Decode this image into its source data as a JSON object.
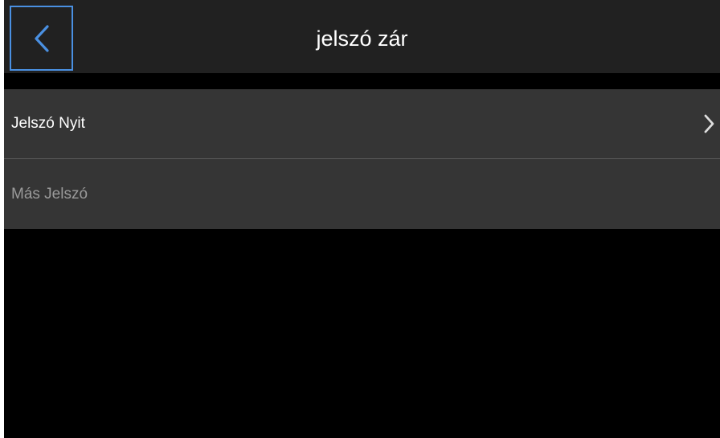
{
  "header": {
    "title": "jelszó zár",
    "back_icon": "chevron-left-icon",
    "focus_color": "#4a90e2"
  },
  "settings": {
    "items": [
      {
        "label": "Jelszó Nyit",
        "enabled": true,
        "icon": "chevron-right-icon"
      },
      {
        "label": "Más Jelszó",
        "enabled": false
      }
    ]
  },
  "colors": {
    "background": "#000000",
    "header": "#212121",
    "list": "#353535",
    "text_primary": "#ffffff",
    "text_disabled": "#9a9a9a"
  }
}
